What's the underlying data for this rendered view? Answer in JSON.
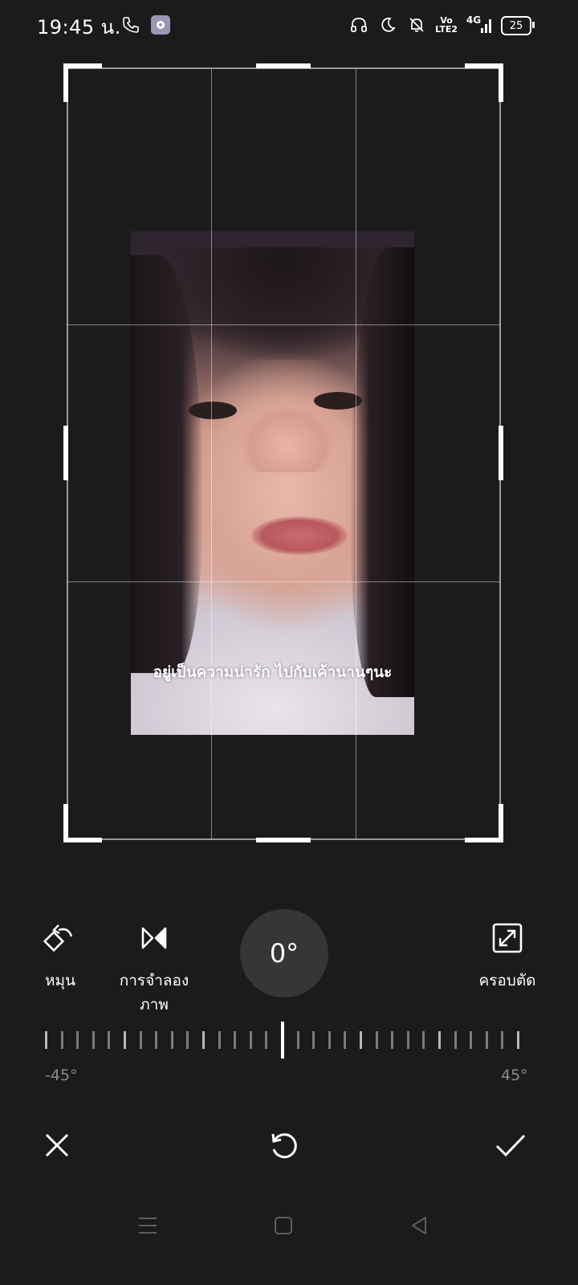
{
  "status_bar": {
    "time": "19:45 น.",
    "volte": "Vo\nLTE2",
    "network": "4G",
    "battery": "25",
    "icons": [
      "phone-icon",
      "gear-icon",
      "headphones-icon",
      "moon-icon",
      "bell-off-icon",
      "volte-icon",
      "signal-icon",
      "battery-icon"
    ]
  },
  "photo": {
    "caption": "อยู่เป็นความน่ารัก ไปกับเค้านานๆนะ"
  },
  "tools": {
    "rotate_label": "หมุน",
    "mirror_label_line1": "การจำลอง",
    "mirror_label_line2": "ภาพ",
    "crop_label": "ครอบตัด",
    "angle_value": "0°"
  },
  "ruler": {
    "min_label": "-45°",
    "max_label": "45°",
    "current_angle": 0
  },
  "actions": {
    "cancel_icon": "close-icon",
    "reset_icon": "reset-icon",
    "confirm_icon": "check-icon"
  },
  "navbar": {
    "icons": [
      "menu-icon",
      "home-icon",
      "back-icon"
    ]
  },
  "colors": {
    "background": "#1b1b1b",
    "dial": "#363636",
    "accent": "#ffffff"
  }
}
